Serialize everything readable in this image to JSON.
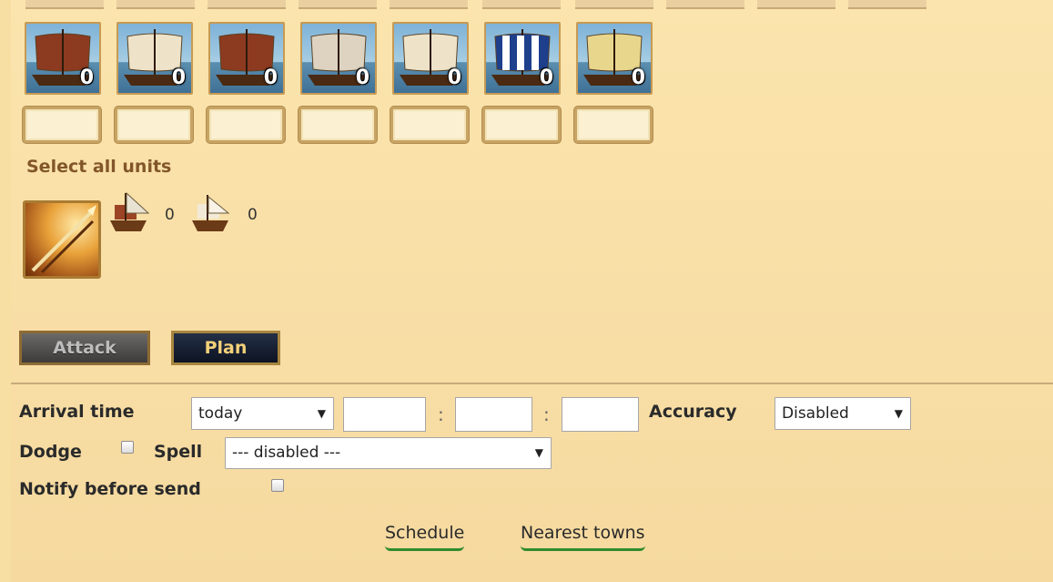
{
  "units": [
    {
      "name": "big-transporter",
      "count": "0",
      "sail": "#8c3a20"
    },
    {
      "name": "bireme",
      "count": "0",
      "sail": "#eee3c9"
    },
    {
      "name": "attack-ship",
      "count": "0",
      "sail": "#8c3a20"
    },
    {
      "name": "demolition-ship",
      "count": "0",
      "sail": "#ddd3c0"
    },
    {
      "name": "small-transporter",
      "count": "0",
      "sail": "#eee3c9"
    },
    {
      "name": "trireme",
      "count": "0",
      "sail": "#1d3f8c"
    },
    {
      "name": "colonize-ship",
      "count": "0",
      "sail": "#e9d68d"
    }
  ],
  "select_all_label": "Select all units",
  "capacity": [
    {
      "icon": "transport-ship-icon",
      "count": "0"
    },
    {
      "icon": "small-transport-icon",
      "count": "0"
    }
  ],
  "buttons": {
    "attack": "Attack",
    "plan": "Plan"
  },
  "arrival": {
    "label": "Arrival time",
    "day_value": "today",
    "separator": ":",
    "accuracy_label": "Accuracy",
    "accuracy_value": "Disabled"
  },
  "dodge_label": "Dodge",
  "spell": {
    "label": "Spell",
    "value": "--- disabled ---"
  },
  "notify_label": "Notify before send",
  "links": {
    "schedule": "Schedule",
    "nearest": "Nearest towns"
  }
}
